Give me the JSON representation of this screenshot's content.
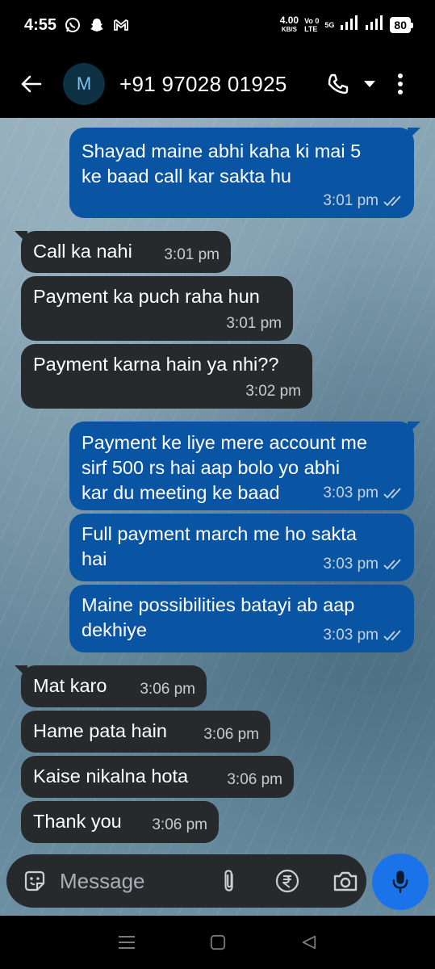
{
  "status_bar": {
    "time": "4:55",
    "icons": [
      "whatsapp-icon",
      "snapchat-icon",
      "gmail-icon"
    ],
    "net_speed_value": "4.00",
    "net_speed_unit": "KB/S",
    "volte": "Vo 0\nLTE",
    "network_5g": "5G",
    "battery": "80"
  },
  "app_bar": {
    "avatar_letter": "M",
    "contact": "+91 97028 01925"
  },
  "messages": [
    {
      "dir": "out",
      "text": "Shayad maine abhi kaha ki mai 5\nke baad call kar sakta hu",
      "time": "3:01 pm"
    },
    {
      "dir": "in",
      "text": "Call ka nahi",
      "time": "3:01 pm"
    },
    {
      "dir": "in",
      "text": "Payment ka puch raha hun",
      "time": "3:01 pm"
    },
    {
      "dir": "in",
      "text": "Payment karna hain ya nhi??",
      "time": "3:02 pm"
    },
    {
      "dir": "out",
      "text": "Payment ke liye mere account me\nsirf 500 rs hai aap bolo yo abhi\nkar du meeting ke baad",
      "time": "3:03 pm"
    },
    {
      "dir": "out",
      "text": "Full payment march me ho sakta\nhai",
      "time": "3:03 pm"
    },
    {
      "dir": "out",
      "text": "Maine possibilities batayi ab aap\ndekhiye",
      "time": "3:03 pm"
    },
    {
      "dir": "in",
      "text": "Mat karo",
      "time": "3:06 pm"
    },
    {
      "dir": "in",
      "text": "Hame pata hain",
      "time": "3:06 pm"
    },
    {
      "dir": "in",
      "text": "Kaise nikalna hota",
      "time": "3:06 pm"
    },
    {
      "dir": "in",
      "text": "Thank you",
      "time": "3:06 pm"
    }
  ],
  "composer": {
    "placeholder": "Message"
  },
  "colors": {
    "outgoing_bubble": "#0a55a3",
    "incoming_bubble": "#262a2d",
    "mic_button": "#1a73e8"
  }
}
